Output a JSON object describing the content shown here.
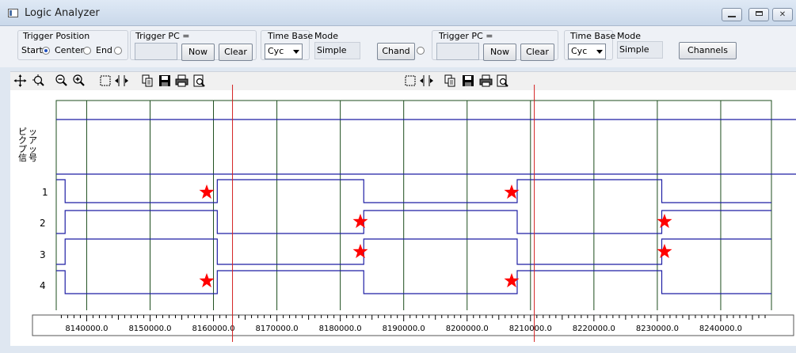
{
  "window": {
    "title": "Logic Analyzer"
  },
  "trigger_position": {
    "label": "Trigger Position",
    "options": [
      "Start",
      "Center",
      "End"
    ],
    "selected": "Start"
  },
  "left_panel": {
    "trigger_pc_label": "Trigger PC =",
    "now_label": "Now",
    "clear_label": "Clear",
    "time_base_label": "Time Base",
    "time_base_value": "Cyc",
    "mode_label": "Mode",
    "mode_value": "Simple"
  },
  "chand_label": "Chand",
  "right_panel": {
    "trigger_pc_label": "Trigger PC =",
    "now_label": "Now",
    "clear_label": "Clear",
    "time_base_label": "Time Base",
    "time_base_value": "Cyc",
    "mode_label": "Mode",
    "mode_value": "Simple",
    "channels_label": "Channels"
  },
  "toolbar_icons": [
    "move-icon",
    "zoom-fit-icon",
    "zoom-out-icon",
    "zoom-in-icon",
    "select-icon",
    "expand-icon",
    "copy-icon",
    "save-icon",
    "print-icon",
    "print-preview-icon"
  ],
  "channels": {
    "pickup_label": "ピックアップ信号",
    "labels": [
      "1",
      "2",
      "3",
      "4"
    ]
  },
  "colors": {
    "trace": "#1f1fa5",
    "grid": "#1c4d1c",
    "cursor": "#d42020",
    "marker": "#ff0000"
  },
  "timeline": {
    "tick_labels": [
      "8140000.0",
      "8150000.0",
      "8160000.0",
      "8170000.0",
      "8180000.0",
      "8190000.0",
      "8200000.0",
      "8210000.0",
      "8220000.0",
      "8230000.0",
      "8240000.0"
    ],
    "cursors": [
      8163000,
      8210600
    ]
  }
}
